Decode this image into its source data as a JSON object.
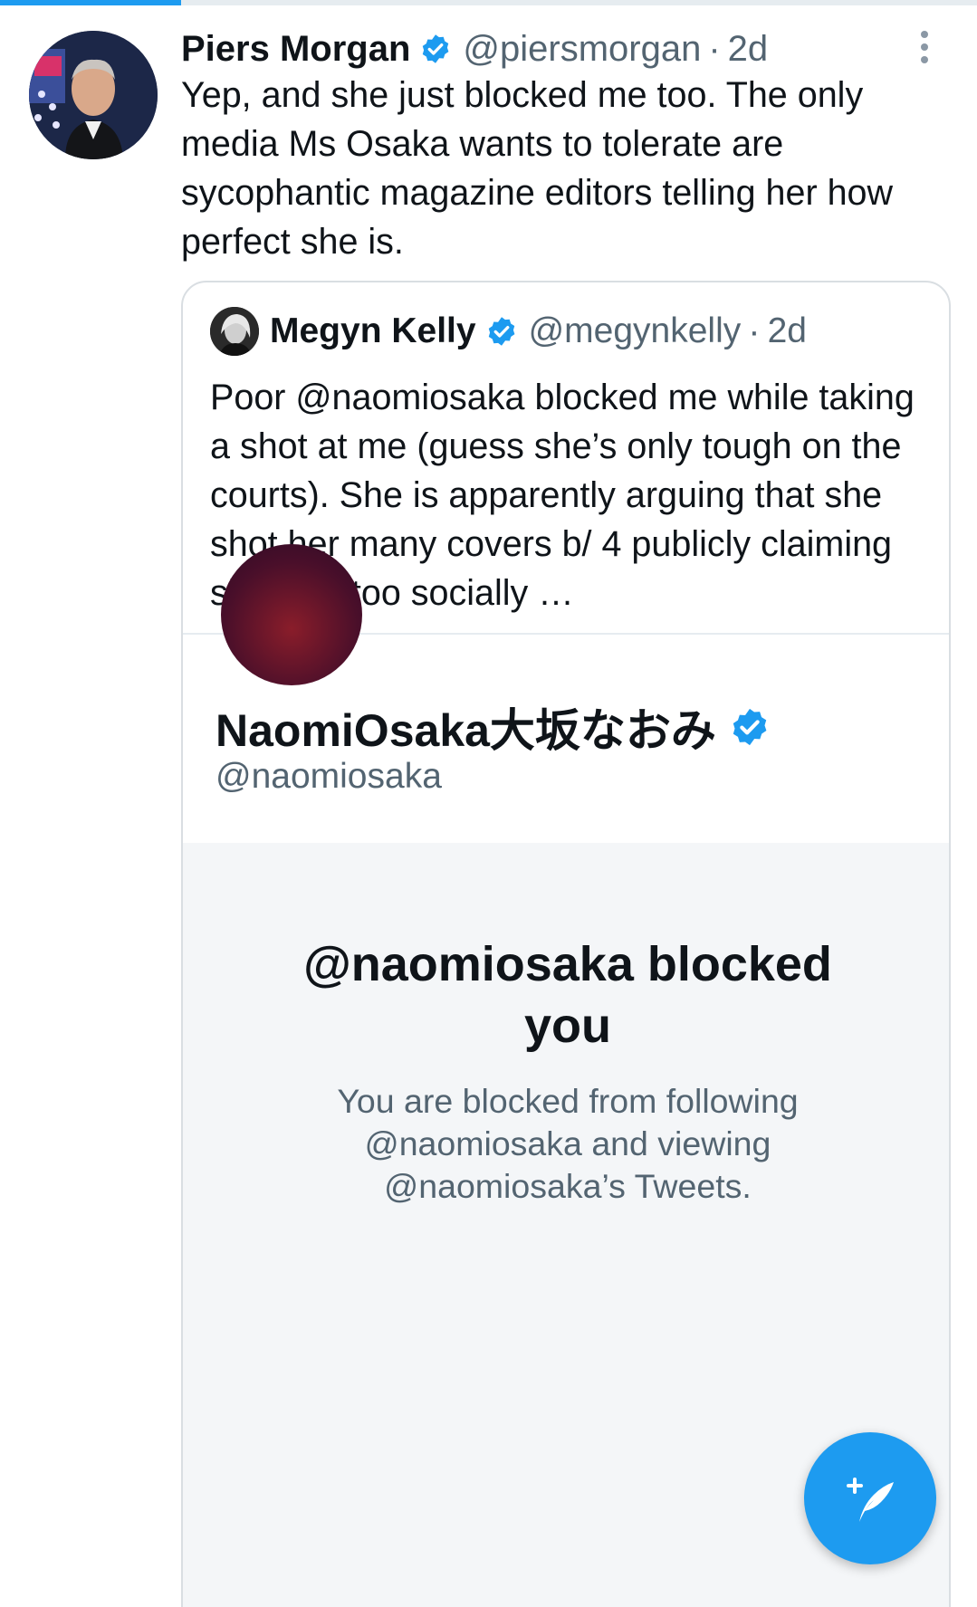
{
  "colors": {
    "accent": "#1d9bf0",
    "text_primary": "#0f1419",
    "text_secondary": "#536471",
    "blocked_panel_bg": "#f4f6f8"
  },
  "tweet": {
    "author_name": "Piers Morgan",
    "author_handle": "@piersmorgan",
    "separator": "·",
    "time": "2d",
    "text": "Yep, and she just blocked me too. The only media Ms Osaka wants to tolerate are sycophantic magazine editors telling her how perfect she is.",
    "avatar_icon": "profile-photo",
    "verified_icon": "verified-badge-icon",
    "more_icon": "more-vertical-icon"
  },
  "quoted_tweet": {
    "author_name": "Megyn Kelly",
    "author_handle": "@megynkelly",
    "separator": "·",
    "time": "2d",
    "text": "Poor @naomiosaka blocked me while taking a shot at me (guess she’s only tough on the courts). She is apparently arguing that she shot her many covers b/ 4 publicly claiming she was too socially …"
  },
  "embedded_profile": {
    "name": "NaomiOsaka大坂なおみ",
    "handle": "@naomiosaka",
    "blocked_title": "@naomiosaka blocked you",
    "blocked_message": "You are blocked from following @naomiosaka and viewing @naomiosaka’s Tweets."
  },
  "compose_button": {
    "icon": "compose-tweet-icon"
  }
}
